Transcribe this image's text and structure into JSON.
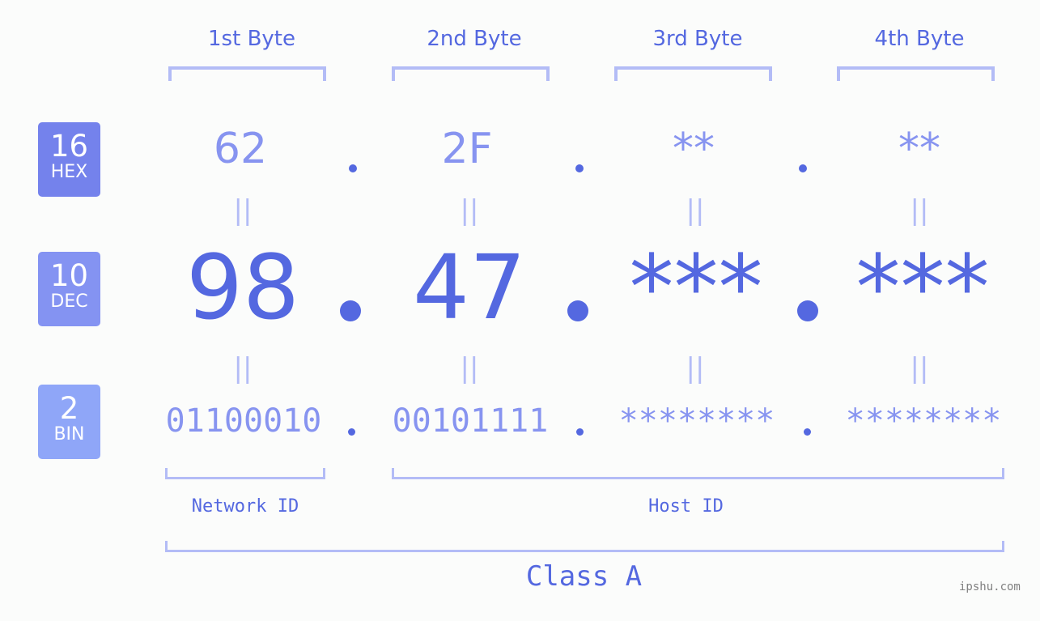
{
  "bytes": [
    {
      "header": "1st Byte",
      "hex": "62",
      "dec": "98",
      "bin": "01100010"
    },
    {
      "header": "2nd Byte",
      "hex": "2F",
      "dec": "47",
      "bin": "00101111"
    },
    {
      "header": "3rd Byte",
      "hex": "**",
      "dec": "***",
      "bin": "********"
    },
    {
      "header": "4th Byte",
      "hex": "**",
      "dec": "***",
      "bin": "********"
    }
  ],
  "badges": {
    "hex": {
      "num": "16",
      "label": "HEX",
      "color": "#7482ec"
    },
    "dec": {
      "num": "10",
      "label": "DEC",
      "color": "#8493f2"
    },
    "bin": {
      "num": "2",
      "label": "BIN",
      "color": "#8fa6f8"
    }
  },
  "equals_sign": "||",
  "network_id_label": "Network ID",
  "host_id_label": "Host ID",
  "class_label": "Class A",
  "watermark": "ipshu.com",
  "colors": {
    "accent": "#5468e0",
    "light_accent": "#8794f0",
    "bracket": "#b3bcf6",
    "background": "#fbfcfb"
  }
}
